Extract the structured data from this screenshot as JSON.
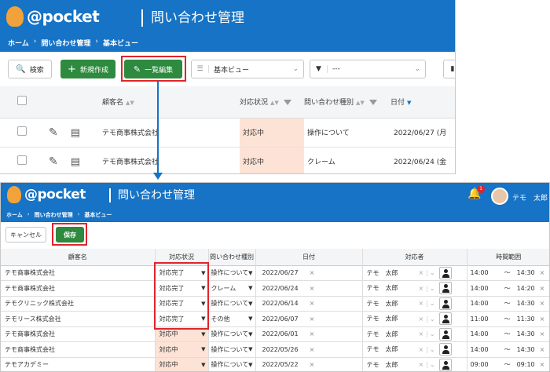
{
  "top": {
    "logo": "@pocket",
    "title": "問い合わせ管理",
    "breadcrumb": [
      "ホーム",
      "問い合わせ管理",
      "基本ビュー"
    ],
    "toolbar": {
      "search": "検索",
      "new": "新規作成",
      "bulk_edit": "一覧編集",
      "view": "基本ビュー",
      "filter": "---"
    },
    "columns": [
      "顧客名",
      "対応状況",
      "問い合わせ種別",
      "日付"
    ],
    "rows": [
      {
        "customer": "テモ商事株式会社",
        "status": "対応中",
        "type": "操作について",
        "date": "2022/06/27 (月"
      },
      {
        "customer": "テモ商事株式会社",
        "status": "対応中",
        "type": "クレーム",
        "date": "2022/06/24 (金"
      }
    ]
  },
  "bottom": {
    "logo": "@pocket",
    "title": "問い合わせ管理",
    "breadcrumb": [
      "ホーム",
      "問い合わせ管理",
      "基本ビュー"
    ],
    "notification_count": "1",
    "user_name": "テモ　太郎",
    "cancel": "キャンセル",
    "save": "保存",
    "columns": [
      "顧客名",
      "対応状況",
      "問い合わせ種別",
      "日付",
      "対応者",
      "時間範囲"
    ],
    "rows": [
      {
        "customer": "テモ商事株式会社",
        "status": "対応完了",
        "type": "操作について",
        "date": "2022/06/27",
        "handler": "テモ　太郎",
        "start": "14:00",
        "end": "14:30"
      },
      {
        "customer": "テモ商事株式会社",
        "status": "対応完了",
        "type": "クレーム",
        "date": "2022/06/24",
        "handler": "テモ　太郎",
        "start": "14:00",
        "end": "14:20"
      },
      {
        "customer": "テモクリニック株式会社",
        "status": "対応完了",
        "type": "操作について",
        "date": "2022/06/14",
        "handler": "テモ　太郎",
        "start": "14:00",
        "end": "14:30"
      },
      {
        "customer": "テモリース株式会社",
        "status": "対応完了",
        "type": "その他",
        "date": "2022/06/07",
        "handler": "テモ　太郎",
        "start": "11:00",
        "end": "11:30"
      },
      {
        "customer": "テモ商事株式会社",
        "status": "対応中",
        "type": "操作について",
        "date": "2022/06/01",
        "handler": "テモ　太郎",
        "start": "14:00",
        "end": "14:30"
      },
      {
        "customer": "テモ商事株式会社",
        "status": "対応中",
        "type": "操作について",
        "date": "2022/05/26",
        "handler": "テモ　太郎",
        "start": "14:00",
        "end": "14:30"
      },
      {
        "customer": "テモアカデミー",
        "status": "対応中",
        "type": "操作について",
        "date": "2022/05/22",
        "handler": "テモ　太郎",
        "start": "09:00",
        "end": "09:10"
      }
    ]
  },
  "colors": {
    "header": "#1673c5",
    "green": "#2d8a3e",
    "highlight": "#e0242c",
    "pink": "#fde3d6"
  }
}
